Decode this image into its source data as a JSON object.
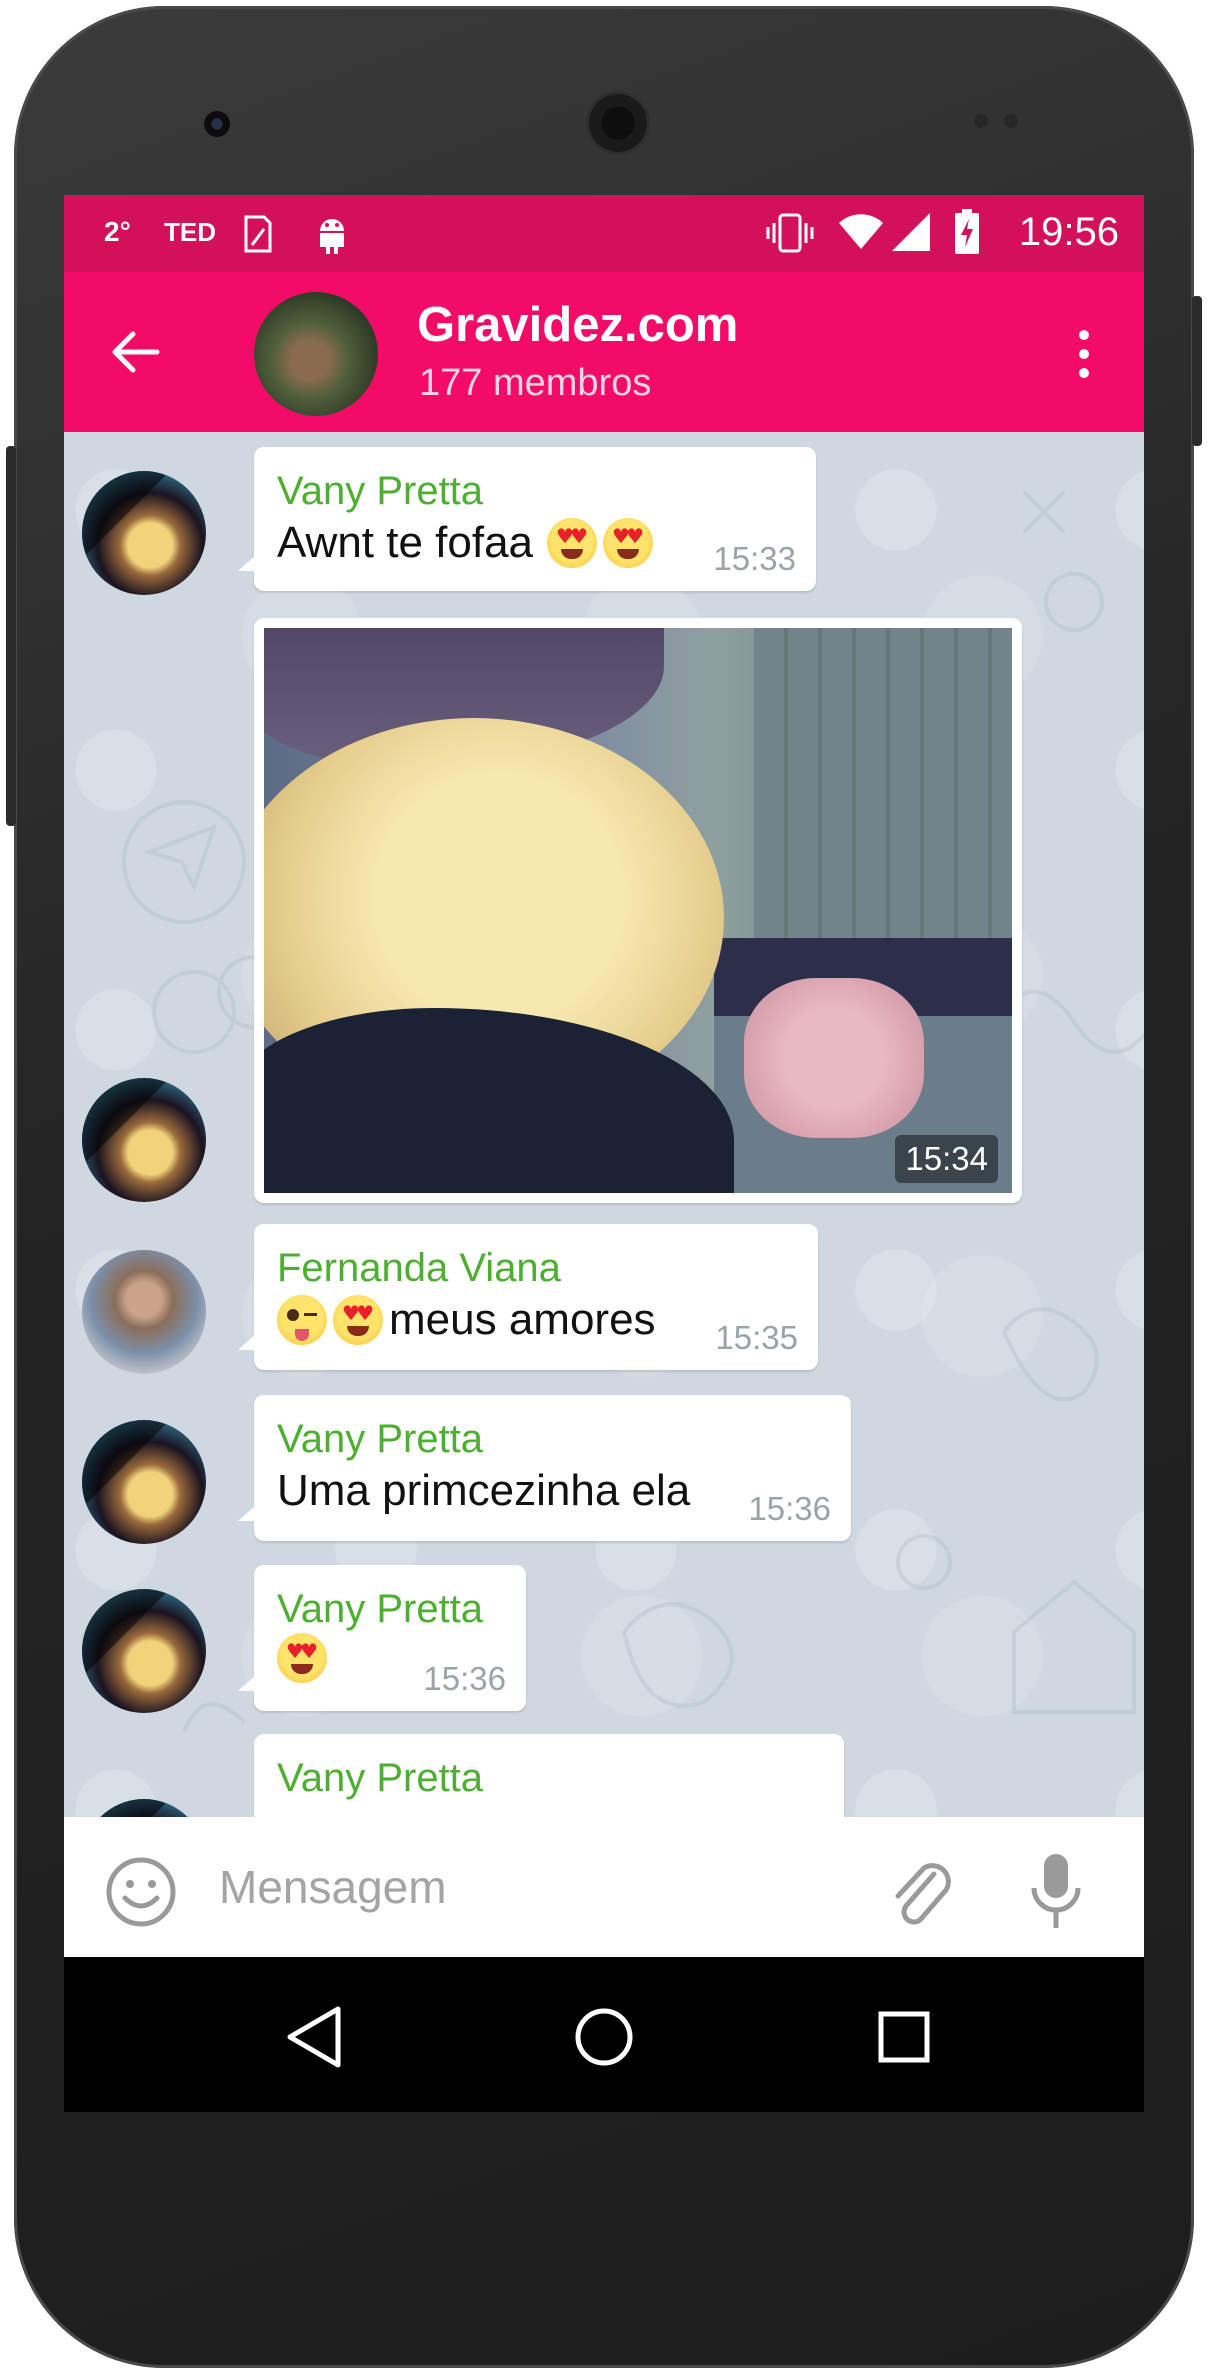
{
  "statusbar": {
    "left_items": [
      "2°",
      "TED"
    ],
    "time": "19:56"
  },
  "chat_header": {
    "title": "Gravidez.com",
    "subtitle": "177 membros"
  },
  "messages": [
    {
      "sender": "Vany Pretta",
      "text": "Awnt te fofaa",
      "emojis": [
        "heart-eyes-emoji",
        "heart-eyes-emoji"
      ],
      "time": "15:33"
    },
    {
      "sender": "",
      "type": "photo",
      "time": "15:34"
    },
    {
      "sender": "Fernanda Viana",
      "text_emojis_before": [
        "winking-tongue-emoji",
        "heart-eyes-emoji"
      ],
      "text": "meus  amores",
      "time": "15:35"
    },
    {
      "sender": "Vany Pretta",
      "text": "Uma primcezinha ela",
      "time": "15:36"
    },
    {
      "sender": "Vany Pretta",
      "text": "",
      "emojis": [
        "heart-eyes-emoji"
      ],
      "time": "15:36"
    },
    {
      "sender": "Vany Pretta",
      "text": "",
      "time": ""
    }
  ],
  "composer": {
    "placeholder": "Mensagem"
  },
  "colors": {
    "statusbar": "#d3115a",
    "appbar": "#f20c68",
    "sender_name": "#4caf2f",
    "chat_background": "#cfd8e0"
  }
}
